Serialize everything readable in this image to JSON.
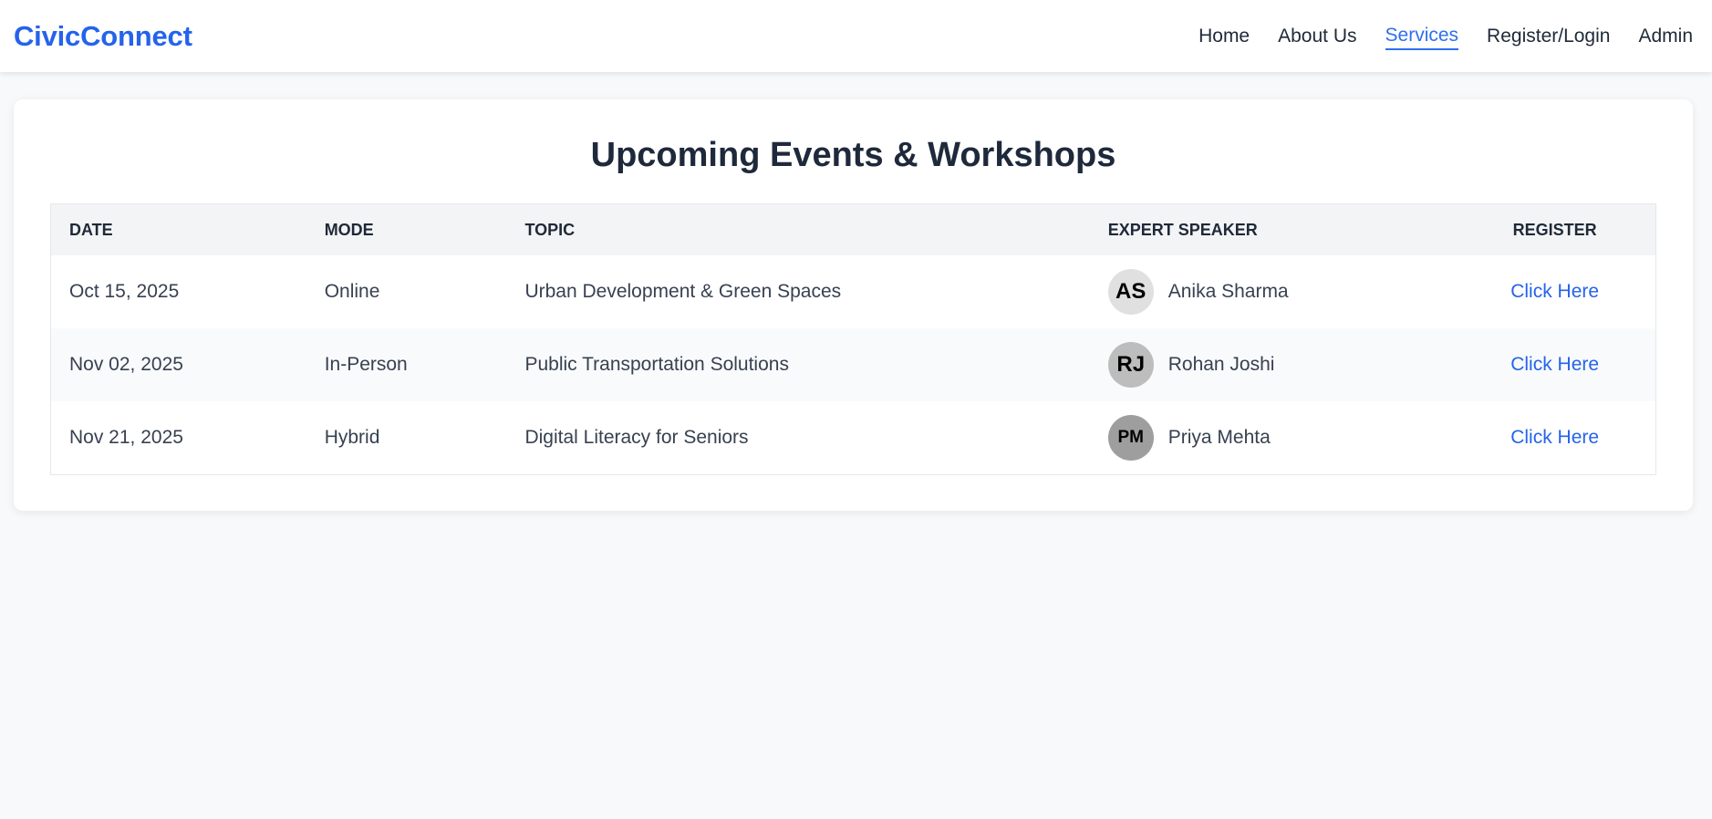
{
  "brand": "CivicConnect",
  "nav": [
    {
      "label": "Home",
      "active": false
    },
    {
      "label": "About Us",
      "active": false
    },
    {
      "label": "Services",
      "active": true
    },
    {
      "label": "Register/Login",
      "active": false
    },
    {
      "label": "Admin",
      "active": false
    }
  ],
  "page_title": "Upcoming Events & Workshops",
  "table": {
    "headers": {
      "date": "DATE",
      "mode": "MODE",
      "topic": "TOPIC",
      "speaker": "EXPERT SPEAKER",
      "register": "REGISTER"
    },
    "rows": [
      {
        "date": "Oct 15, 2025",
        "mode": "Online",
        "topic": "Urban Development & Green Spaces",
        "initials": "AS",
        "speaker": "Anika Sharma",
        "register": "Click Here",
        "avatar_color": "#e0e0e0"
      },
      {
        "date": "Nov 02, 2025",
        "mode": "In-Person",
        "topic": "Public Transportation Solutions",
        "initials": "RJ",
        "speaker": "Rohan Joshi",
        "register": "Click Here",
        "avatar_color": "#bdbdbd"
      },
      {
        "date": "Nov 21, 2025",
        "mode": "Hybrid",
        "topic": "Digital Literacy for Seniors",
        "initials": "PM",
        "speaker": "Priya Mehta",
        "register": "Click Here",
        "avatar_color": "#9e9e9e"
      }
    ]
  },
  "colors": {
    "brand": "#2563eb",
    "link": "#2563eb",
    "active_nav": "#2f6fed",
    "background": "#f8f9fb"
  }
}
